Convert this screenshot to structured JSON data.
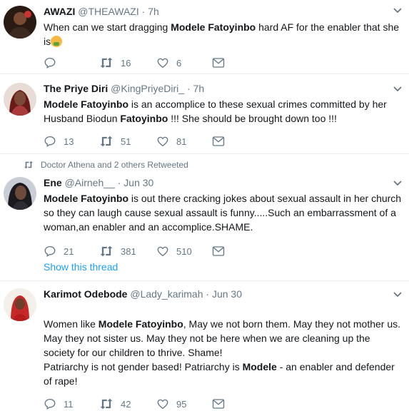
{
  "tweets": [
    {
      "name": "AWAZI",
      "handle": "@THEAWAZI",
      "time": "7h",
      "segments": [
        {
          "text": "When can we start dragging ",
          "bold": false
        },
        {
          "text": "Modele Fatoyinbo",
          "bold": true
        },
        {
          "text": " hard AF for the enabler that she is",
          "bold": false
        }
      ],
      "emoji": "nauseated-face-emoji",
      "replies": "",
      "retweets": "16",
      "likes": "6"
    },
    {
      "name": "The Priye Diri",
      "handle": "@KingPriyeDiri_",
      "time": "7h",
      "segments": [
        {
          "text": "Modele Fatoyinbo",
          "bold": true
        },
        {
          "text": " is an accomplice to these sexual crimes committed by her Husband Biodun ",
          "bold": false
        },
        {
          "text": "Fatoyinbo",
          "bold": true
        },
        {
          "text": " !!! She should be brought down too !!!",
          "bold": false
        }
      ],
      "replies": "13",
      "retweets": "51",
      "likes": "81"
    },
    {
      "retweet_context": "Doctor Athena and 2 others Retweeted",
      "name": "Ene",
      "handle": "@Airneh__",
      "time": "Jun 30",
      "segments": [
        {
          "text": "Modele Fatoyinbo",
          "bold": true
        },
        {
          "text": " is out there cracking jokes about sexual assault in her church so they can laugh cause sexual assault is funny.....Such an embarrassment of a woman,an enabler and an accomplice.SHAME.",
          "bold": false
        }
      ],
      "replies": "21",
      "retweets": "381",
      "likes": "510",
      "show_thread": "Show this thread"
    },
    {
      "name": "Karimot Odebode",
      "handle": "@Lady_karimah",
      "time": "Jun 30",
      "segments": [
        {
          "text": "Women like ",
          "bold": false
        },
        {
          "text": "Modele Fatoyinbo",
          "bold": true
        },
        {
          "text": ", May we not born them. May they not mother us. May they not sister us. May they not be here when we are cleaning up the society for our children to thrive. Shame!",
          "bold": false
        },
        {
          "text": "\nPatriarchy is not gender based! Patriarchy is ",
          "bold": false
        },
        {
          "text": "Modele",
          "bold": true
        },
        {
          "text": " - an enabler and defender of rape!",
          "bold": false
        }
      ],
      "replies": "11",
      "retweets": "42",
      "likes": "95"
    }
  ],
  "colors": {
    "accent": "#1da1f2",
    "secondary_text": "#657786",
    "divider": "#e6ecf0"
  },
  "icons": [
    "reply-icon",
    "retweet-icon",
    "like-icon",
    "message-icon",
    "caret-down-icon"
  ]
}
